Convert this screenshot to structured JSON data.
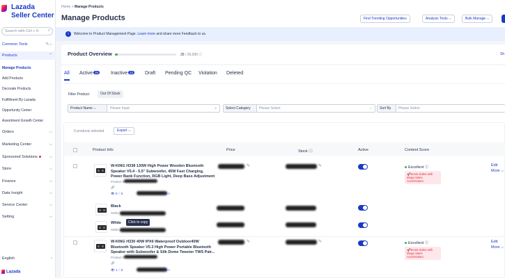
{
  "sidebar": {
    "logo_line1": "Lazada",
    "logo_line2": "Seller Center",
    "search_placeholder": "Search with Ctrl + K",
    "common_tools": "Common Tools",
    "products": "Products",
    "sub_items": [
      "Manage Products",
      "Add Products",
      "Decorate Products",
      "Fulfillment By Lazada",
      "Opportunity Center",
      "Assortment Growth Center"
    ],
    "items": [
      "Orders",
      "Marketing Center",
      "Sponsored Solutions",
      "Store",
      "Finance",
      "Data Insight",
      "Service Center",
      "Setting"
    ],
    "language": "English",
    "footer_brand": "Lazada"
  },
  "header": {
    "breadcrumb_home": "Home",
    "breadcrumb_sep": ">",
    "breadcrumb_current": "Manage Products",
    "title": "Manage Products",
    "buttons": [
      "Find Trending Opportunities",
      "Analysis Tools ⌵",
      "Bulk Manage ⌵"
    ]
  },
  "banner": {
    "prefix": "Welcome to Product Management Page.",
    "link": "Learn more",
    "suffix": "and share more Feedback to us."
  },
  "overview": {
    "title": "Product Overview",
    "progress": 0.0013,
    "count": "26",
    "total": "/ 20,000",
    "show": "Sh"
  },
  "tabs": [
    {
      "label": "All"
    },
    {
      "label": "Active",
      "count": "26"
    },
    {
      "label": "Inactive",
      "count": "22"
    },
    {
      "label": "Draft"
    },
    {
      "label": "Pending QC"
    },
    {
      "label": "Violation"
    },
    {
      "label": "Deleted"
    }
  ],
  "filters": {
    "filter_label": "Filter Product:",
    "chip": "Out Of Stock",
    "product_name_seg": "Product Name",
    "product_name_ph": "Please Input",
    "category_seg": "Select Category",
    "category_ph": "Please Select",
    "sort_seg": "Sort By",
    "sort_ph": "Please Select"
  },
  "table": {
    "selected": "0 products selected",
    "export": "Export",
    "headers": [
      "Product Info",
      "Price",
      "Stock",
      "Active",
      "Content Score"
    ],
    "products": [
      {
        "name": "W-KING H338 130W High Power Wooden Bluetooth Speaker V5.4 - 5.5\" Subwoofer, 45W Fast Charging, Power Bank Function, RGB Light, Deep Bass Adjustment",
        "id_label": "Product ID",
        "stats": "0  ♡4",
        "rating": "5.0 >",
        "score": "Excellent",
        "boost": "Boost Sales with Mega Sales Accelerators",
        "actions": [
          "Edit",
          "More ⌵"
        ],
        "variants": [
          {
            "name": "Black",
            "sku": "Seller Sku"
          },
          {
            "name": "White",
            "sku": "Seller Sku"
          }
        ]
      },
      {
        "name": "W-KING H330 40W IPX6 Waterproof Outdoor40W Bluetooth Speaker V5.3 High Power Portable Bluetooth Speaker with Subwoofer & Silk Dome Tweeter TWS Pair...",
        "id_label": "Product ID",
        "stats": "1  ♡3",
        "rating": "5.0 >",
        "score": "Excellent",
        "boost": "Boost Sales with Mega Sales Accelerators",
        "actions": [
          "Edit",
          "More ⌵"
        ]
      }
    ],
    "tooltip": "Click to copy"
  }
}
